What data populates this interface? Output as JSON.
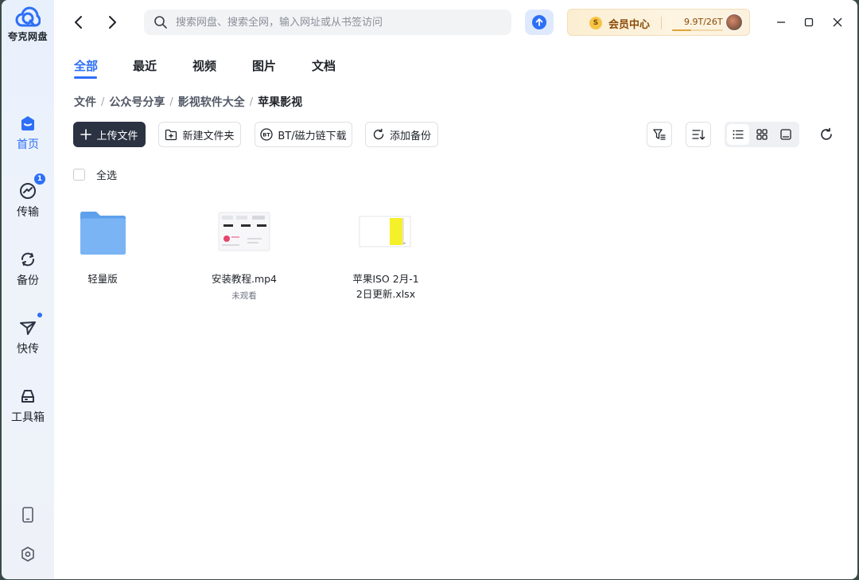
{
  "app": {
    "name": "夸克网盘"
  },
  "sidebar": {
    "items": [
      {
        "label": "首页",
        "icon": "home-icon",
        "active": true
      },
      {
        "label": "传输",
        "icon": "transfer-icon",
        "badge": "1"
      },
      {
        "label": "备份",
        "icon": "backup-icon"
      },
      {
        "label": "快传",
        "icon": "send-icon",
        "dot": true
      },
      {
        "label": "工具箱",
        "icon": "toolbox-icon"
      }
    ],
    "bottom": [
      {
        "icon": "phone-icon"
      },
      {
        "icon": "settings-icon"
      }
    ]
  },
  "search": {
    "placeholder": "搜索网盘、搜索全网，输入网址或从书签访问"
  },
  "member": {
    "coin": "S",
    "title": "会员中心",
    "quota": "9.9T/26T",
    "quota_fraction": 0.38
  },
  "tabs": [
    {
      "label": "全部",
      "active": true
    },
    {
      "label": "最近"
    },
    {
      "label": "视频"
    },
    {
      "label": "图片"
    },
    {
      "label": "文档"
    }
  ],
  "breadcrumb": [
    "文件",
    "公众号分享",
    "影视软件大全",
    "苹果影视"
  ],
  "breadcrumb_separator": "/",
  "toolbar": {
    "upload_label": "上传文件",
    "new_folder_label": "新建文件夹",
    "bt_label": "BT/磁力链下载",
    "backup_label": "添加备份",
    "bt_badge": "BT"
  },
  "view": {
    "selected": "list"
  },
  "select_all_label": "全选",
  "files": [
    {
      "name": "轻量版",
      "type": "folder",
      "meta": ""
    },
    {
      "name": "安装教程.mp4",
      "type": "video",
      "meta": "未观看"
    },
    {
      "name": "苹果ISO 2月-12日更新.xlsx",
      "type": "xlsx",
      "meta": ""
    }
  ],
  "colors": {
    "accent": "#2d6ff7",
    "primary_button": "#2b3242",
    "member_text": "#8b4a06",
    "folder": "#6aa8f0"
  }
}
